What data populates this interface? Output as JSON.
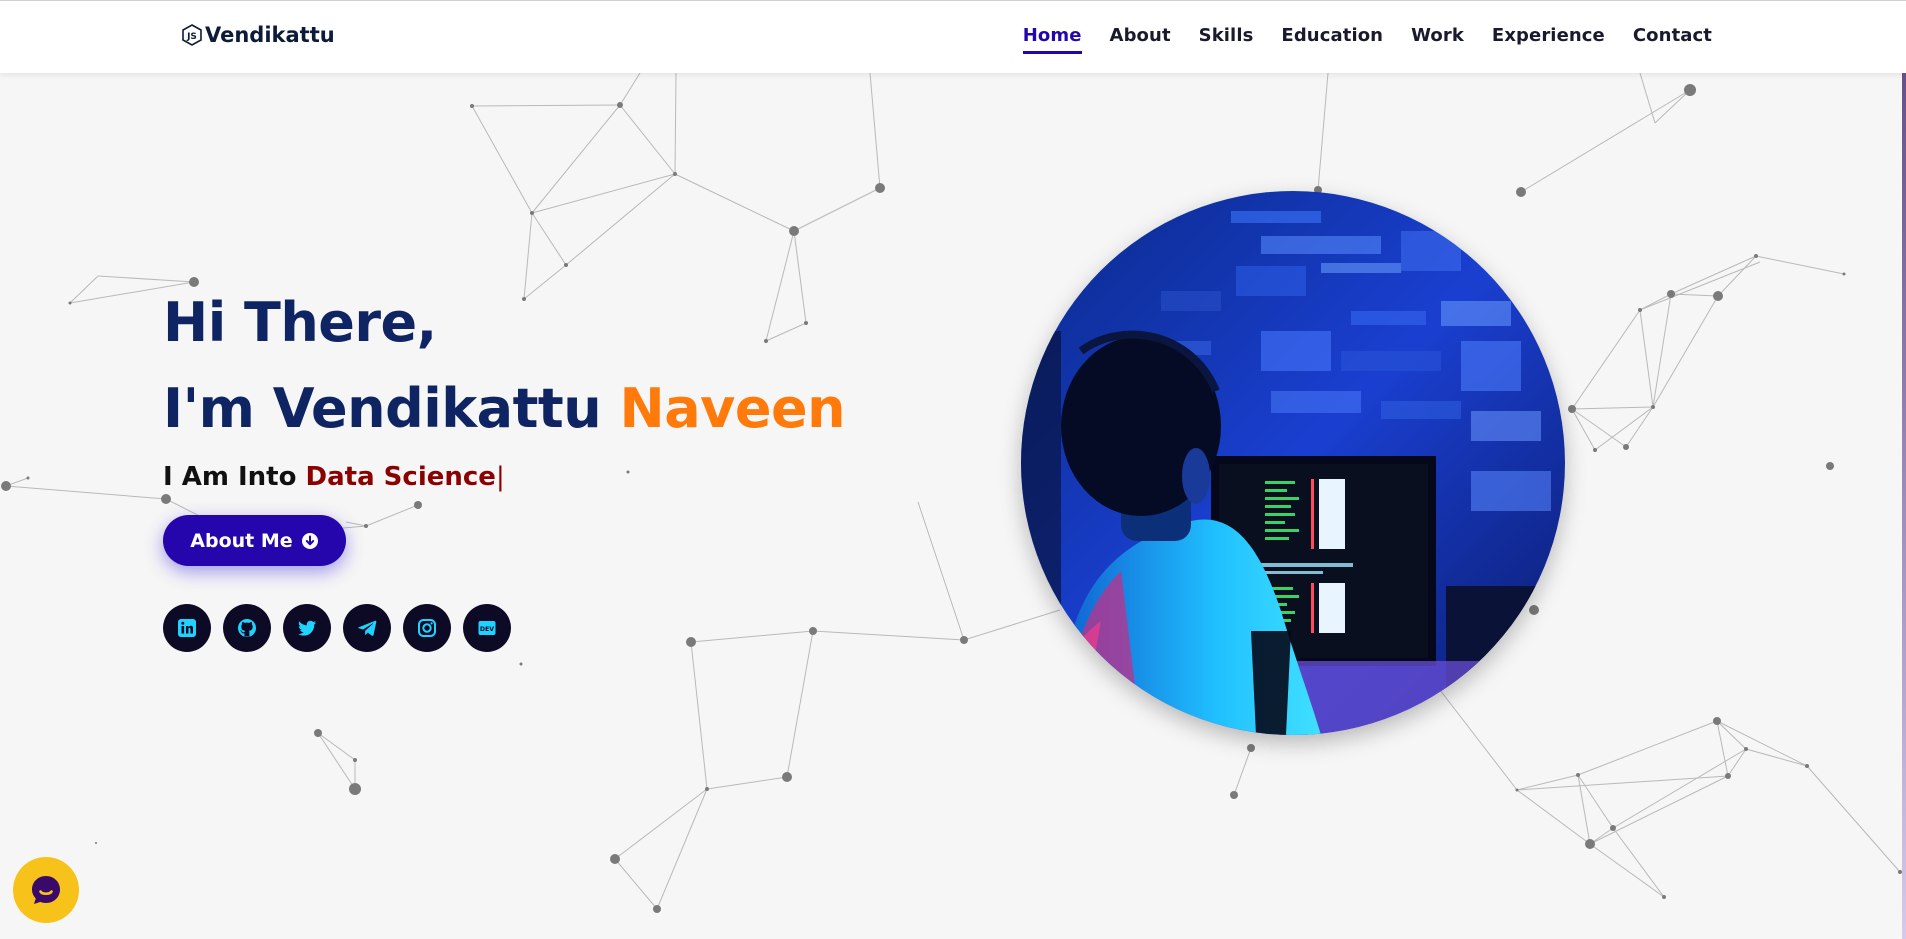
{
  "brand": {
    "name": "Vendikattu",
    "logo_icon": "js-hexagon-icon"
  },
  "nav": {
    "items": [
      {
        "label": "Home",
        "active": true
      },
      {
        "label": "About",
        "active": false
      },
      {
        "label": "Skills",
        "active": false
      },
      {
        "label": "Education",
        "active": false
      },
      {
        "label": "Work",
        "active": false
      },
      {
        "label": "Experience",
        "active": false
      },
      {
        "label": "Contact",
        "active": false
      }
    ]
  },
  "hero": {
    "greeting": "Hi There,",
    "intro_prefix": "I'm Vendikattu",
    "intro_accent": "Naveen",
    "typed_prefix": "I Am Into",
    "typed_word": "Data Science",
    "cursor": "|",
    "about_button": "About Me",
    "about_button_icon": "arrow-down-circle-icon"
  },
  "socials": [
    {
      "name": "linkedin-icon"
    },
    {
      "name": "github-icon"
    },
    {
      "name": "twitter-icon"
    },
    {
      "name": "telegram-icon"
    },
    {
      "name": "instagram-icon"
    },
    {
      "name": "dev-icon",
      "text": "DEV"
    }
  ],
  "hero_image": {
    "description_icon": "developer-at-computer-image"
  },
  "chat_widget": {
    "icon": "chat-bubble-icon"
  },
  "colors": {
    "accent_blue": "#2506ad",
    "heading": "#0f2463",
    "accent_orange": "#ff7a0b",
    "typed": "#8b0000",
    "social_bg": "#0c0a25",
    "social_fg": "#1fd3ff",
    "chat_bg": "#f7c21a"
  }
}
